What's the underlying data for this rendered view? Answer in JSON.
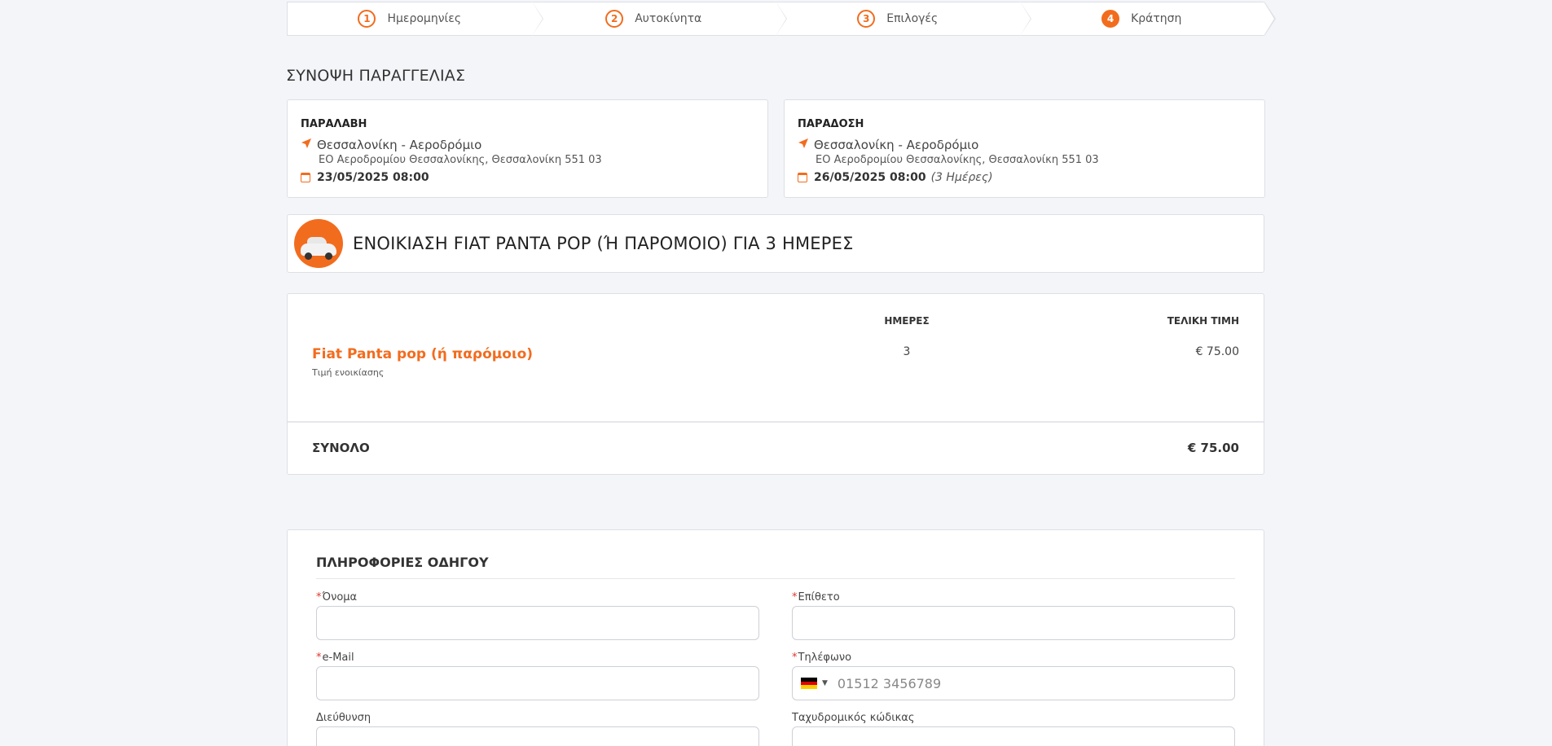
{
  "steps": [
    {
      "num": "1",
      "label": "Ημερομηνίες"
    },
    {
      "num": "2",
      "label": "Αυτοκίνητα"
    },
    {
      "num": "3",
      "label": "Επιλογές"
    },
    {
      "num": "4",
      "label": "Κράτηση"
    }
  ],
  "summary_title": "ΣΥΝΟΨΗ ΠΑΡΑΓΓΕΛΙΑΣ",
  "pickup": {
    "title": "ΠΑΡΑΛΑΒΗ",
    "location": "Θεσσαλονίκη - Αεροδρόμιο",
    "address": "ΕΟ Αεροδρομίου Θεσσαλονίκης, Θεσσαλονίκη 551 03",
    "datetime": "23/05/2025 08:00"
  },
  "dropoff": {
    "title": "ΠΑΡΑΔΟΣΗ",
    "location": "Θεσσαλονίκη - Αεροδρόμιο",
    "address": "ΕΟ Αεροδρομίου Θεσσαλονίκης, Θεσσαλονίκη 551 03",
    "datetime": "26/05/2025 08:00",
    "duration": "(3 Ημέρες)"
  },
  "rental_title": "ΕΝΟΙΚΙΑΣΗ FIAT PANTA POP (Ή ΠΑΡΟΜΟΙΟ) ΓΙΑ 3 ΗΜΕΡΕΣ",
  "pricing": {
    "col_days": "ΗΜΕΡΕΣ",
    "col_total": "ΤΕΛΙΚΗ ΤΙΜΗ",
    "car_name": "Fiat Panta pop (ή παρόμοιο)",
    "car_sub": "Τιμή ενοικίασης",
    "days": "3",
    "price": "€ 75.00",
    "total_label": "ΣΥΝΟΛΟ",
    "total_value": "€ 75.00"
  },
  "driver": {
    "title": "ΠΛΗΡΟΦΟΡΙΕΣ ΟΔΗΓΟΥ",
    "first_name_label": "Όνομα",
    "last_name_label": "Επίθετο",
    "email_label": "e-Mail",
    "phone_label": "Τηλέφωνο",
    "phone_placeholder": "01512 3456789",
    "address_label": "Διεύθυνση",
    "postal_label": "Ταχυδρομικός κώδικας",
    "required_mark": "*"
  },
  "colors": {
    "accent": "#f26c1e",
    "required": "#e0372b"
  },
  "icons": {
    "location": "location-arrow-icon",
    "calendar": "calendar-icon",
    "flag": "germany-flag-icon"
  }
}
